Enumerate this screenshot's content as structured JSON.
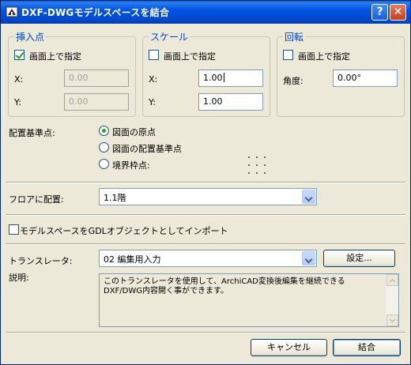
{
  "window": {
    "title": "DXF-DWGモデルスペースを結合",
    "help_label": "?",
    "close_label": "✕"
  },
  "insertion": {
    "title": "挿入点",
    "on_screen_label": "画面上で指定",
    "on_screen_checked": true,
    "x_label": "X:",
    "x_value": "0.00",
    "y_label": "Y:",
    "y_value": "0.00"
  },
  "scale": {
    "title": "スケール",
    "on_screen_label": "画面上で指定",
    "on_screen_checked": false,
    "x_label": "X:",
    "x_value": "1.00",
    "y_label": "Y:",
    "y_value": "1.00"
  },
  "rotation": {
    "title": "回転",
    "on_screen_label": "画面上で指定",
    "on_screen_checked": false,
    "angle_label": "角度:",
    "angle_value": "0.00°"
  },
  "placement": {
    "label": "配置基準点:",
    "options": [
      "図面の原点",
      "図面の配置基準点",
      "境界枠点:"
    ],
    "selected_index": 0
  },
  "floor": {
    "label": "フロアに配置:",
    "value": "1.1階"
  },
  "gdl_import": {
    "label": "モデルスペースをGDLオブジェクトとしてインポート",
    "checked": false
  },
  "translator": {
    "label": "トランスレータ:",
    "value": "02 編集用入力",
    "settings_label": "設定...",
    "description_label": "説明:",
    "description": "このトランスレータを使用して、ArchiCAD変換後編集を継続できるDXF/DWG内容開く事ができます。"
  },
  "footer": {
    "cancel_label": "キャンセル",
    "ok_label": "結合"
  }
}
